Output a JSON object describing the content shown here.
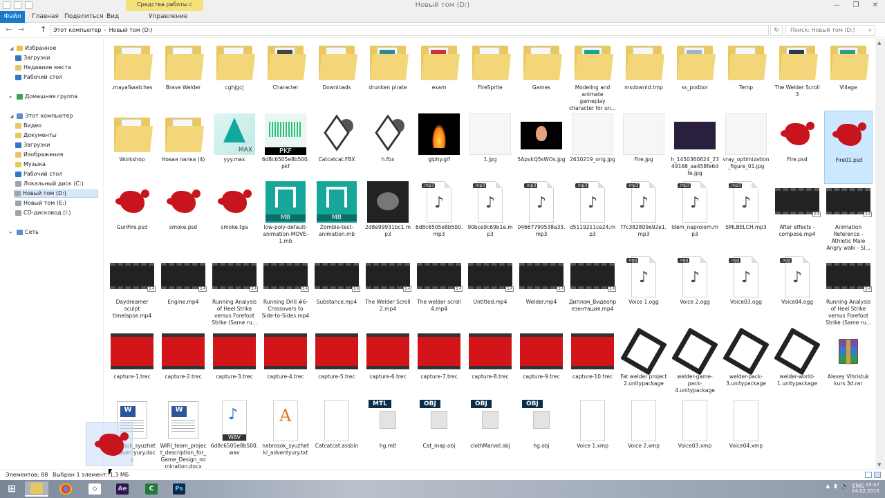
{
  "window": {
    "title": "Новый том (D:)",
    "contextual_tab": "Средства работы с рисунками",
    "minimize": "—",
    "maximize": "❐",
    "close": "✕"
  },
  "ribbon": {
    "tabs": [
      "Файл",
      "Главная",
      "Поделиться",
      "Вид",
      "Управление"
    ]
  },
  "address": {
    "back": "←",
    "forward": "→",
    "up": "↑",
    "crumbs": [
      "Этот компьютер",
      "Новый том (D:)"
    ],
    "refresh": "↻",
    "search_placeholder": "Поиск: Новый том (D:)"
  },
  "sidebar": {
    "favorites": "Избранное",
    "fav_items": [
      "Загрузки",
      "Недавние места",
      "Рабочий стол"
    ],
    "homegroup": "Домашняя группа",
    "computer": "Этот компьютер",
    "pc_items": [
      "Видео",
      "Документы",
      "Загрузки",
      "Изображения",
      "Музыка",
      "Рабочий стол",
      "Локальный диск (C:)",
      "Новый том (D:)",
      "Новый том (E:)",
      "CD-дисковод (I:)"
    ],
    "network": "Сеть"
  },
  "files": [
    {
      "name": ".mayaSwatches",
      "kind": "folder"
    },
    {
      "name": "Brave Welder",
      "kind": "folder"
    },
    {
      "name": "cghjgcj",
      "kind": "folder"
    },
    {
      "name": "Character",
      "kind": "folder"
    },
    {
      "name": "Downloads",
      "kind": "folder"
    },
    {
      "name": "drunken pirate",
      "kind": "folder"
    },
    {
      "name": "exam",
      "kind": "folder"
    },
    {
      "name": "FireSprite",
      "kind": "folder"
    },
    {
      "name": "Games",
      "kind": "folder"
    },
    {
      "name": "Modeling and animate gameplay character for un...",
      "kind": "folder"
    },
    {
      "name": "msdownld.tmp",
      "kind": "folder"
    },
    {
      "name": "ss_podbor",
      "kind": "folder"
    },
    {
      "name": "Temp",
      "kind": "folder"
    },
    {
      "name": "The Welder Scroll 3",
      "kind": "folder"
    },
    {
      "name": "Village",
      "kind": "folder"
    },
    {
      "name": "Workshop",
      "kind": "folder"
    },
    {
      "name": "Новая папка (4)",
      "kind": "folder"
    },
    {
      "name": "yyy.max",
      "kind": "max"
    },
    {
      "name": "6d8c6505e8b500.pkf",
      "kind": "pkf"
    },
    {
      "name": "Catcatcat.FBX",
      "kind": "fbx"
    },
    {
      "name": "h.fbx",
      "kind": "fbx"
    },
    {
      "name": "giphy.gif",
      "kind": "fire"
    },
    {
      "name": "1.jpg",
      "kind": "light"
    },
    {
      "name": "5ApvkQ5sWOs.jpg",
      "kind": "egg"
    },
    {
      "name": "2610219_orig.jpg",
      "kind": "light"
    },
    {
      "name": "Fire.jpg",
      "kind": "light"
    },
    {
      "name": "h_1450360624_2349168_aa458fe6dfe.jpg",
      "kind": "dark"
    },
    {
      "name": "vray_optimization_figure_01.jpg",
      "kind": "light"
    },
    {
      "name": "Fire.psd",
      "kind": "psd"
    },
    {
      "name": "Fire01.psd",
      "kind": "psd",
      "selected": true
    },
    {
      "name": "GunFire.psd",
      "kind": "psd"
    },
    {
      "name": "smoke.psd",
      "kind": "psd"
    },
    {
      "name": "smoke.tga",
      "kind": "psd"
    },
    {
      "name": "low-poly-default-animation-MOVE-1.mb",
      "kind": "mb"
    },
    {
      "name": "Zombie-test-animation.mb",
      "kind": "mb"
    },
    {
      "name": "2d8e99931bc1.mp3",
      "kind": "heart"
    },
    {
      "name": "6d8c6505e8b500.mp3",
      "kind": "mp3"
    },
    {
      "name": "90bce9c69b1e.mp3",
      "kind": "mp3"
    },
    {
      "name": "04667799538a33.mp3",
      "kind": "mp3"
    },
    {
      "name": "d5119211ce24.mp3",
      "kind": "mp3"
    },
    {
      "name": "f7c382809e92e1.mp3",
      "kind": "mp3"
    },
    {
      "name": "ldem_naprolom.mp3",
      "kind": "mp3"
    },
    {
      "name": "SMLBELCH.mp3",
      "kind": "mp3"
    },
    {
      "name": "After effects - compose.mp4",
      "kind": "video"
    },
    {
      "name": "Animation Reference - Athletic Male Angry walk - Sl...",
      "kind": "video"
    },
    {
      "name": "Daydreamer sculpt timelapse.mp4",
      "kind": "video"
    },
    {
      "name": "Engine.mp4",
      "kind": "video"
    },
    {
      "name": "Running Analysis of Heel Strike versus Forefoot Strike (Same ru...",
      "kind": "video"
    },
    {
      "name": "Running Drill #6- Crossovers to Side-to-Sides.mp4",
      "kind": "video"
    },
    {
      "name": "Substance.mp4",
      "kind": "video"
    },
    {
      "name": "The Welder Scroll 2.mp4",
      "kind": "video"
    },
    {
      "name": "The welder scroll 4.mp4",
      "kind": "video"
    },
    {
      "name": "Untitled.mp4",
      "kind": "video"
    },
    {
      "name": "Welder.mp4",
      "kind": "video"
    },
    {
      "name": "Диплом_Видеопрезентация.mp4",
      "kind": "video"
    },
    {
      "name": "Voice 1.ogg",
      "kind": "ogg"
    },
    {
      "name": "Voice 2.ogg",
      "kind": "ogg"
    },
    {
      "name": "Voice03.ogg",
      "kind": "ogg"
    },
    {
      "name": "Voice04.ogg",
      "kind": "ogg"
    },
    {
      "name": "Running Analysis of Heel Strike versus Forefoot Strike (Same ru...",
      "kind": "video"
    },
    {
      "name": "capture-1.trec",
      "kind": "trec"
    },
    {
      "name": "capture-2.trec",
      "kind": "trec"
    },
    {
      "name": "capture-3.trec",
      "kind": "trec"
    },
    {
      "name": "capture-4.trec",
      "kind": "trec"
    },
    {
      "name": "capture-5.trec",
      "kind": "trec"
    },
    {
      "name": "capture-6.trec",
      "kind": "trec"
    },
    {
      "name": "capture-7.trec",
      "kind": "trec"
    },
    {
      "name": "capture-8.trec",
      "kind": "trec"
    },
    {
      "name": "capture-9.trec",
      "kind": "trec"
    },
    {
      "name": "capture-10.trec",
      "kind": "trec"
    },
    {
      "name": "Fat welder project 2.unitypackage",
      "kind": "unity"
    },
    {
      "name": "welder-game-pack-4.unitypackage",
      "kind": "unity"
    },
    {
      "name": "welder-pack-3.unitypackage",
      "kind": "unity"
    },
    {
      "name": "welder-world-1.unitypackage",
      "kind": "unity"
    },
    {
      "name": "Alexey Vihristuk kurs 3d.rar",
      "kind": "rar"
    },
    {
      "name": "nabrosok_syuzhetki_adventyury.docx",
      "kind": "docx"
    },
    {
      "name": "WIRI_team_project_description_for_Game_Design_nomination.docx",
      "kind": "docx"
    },
    {
      "name": "6d8c6505e8b500.wav",
      "kind": "wav"
    },
    {
      "name": "nabrosok_syuzhetki_adventyury.txt",
      "kind": "txt"
    },
    {
      "name": "Catcatcat.assbin",
      "kind": "blank"
    },
    {
      "name": "hg.mtl",
      "kind": "mtl"
    },
    {
      "name": "Cat_map.obj",
      "kind": "obj"
    },
    {
      "name": "clothMarvel.obj",
      "kind": "obj"
    },
    {
      "name": "hg.obj",
      "kind": "obj"
    },
    {
      "name": "Voice 1.xmp",
      "kind": "blank"
    },
    {
      "name": "Voice 2.xmp",
      "kind": "blank"
    },
    {
      "name": "Voice03.xmp",
      "kind": "blank"
    },
    {
      "name": "Voice04.xmp",
      "kind": "blank"
    }
  ],
  "badges": {
    "mp3": ".mp3",
    "ogg": ".ogg",
    "mb": "MB",
    "max": "MAX",
    "pkf": "PKF",
    "mtl": "MTL",
    "obj": "OBJ",
    "wav": "WAV",
    "w": "W",
    "note": "♪",
    "video_tag": "3:4"
  },
  "status": {
    "count": "Элементов: 88",
    "selected": "Выбран 1 элемент: 1,3 МБ"
  },
  "taskbar": {
    "apps": [
      "start-icon",
      "explorer-icon",
      "chrome-icon",
      "unity-icon",
      "after-effects-icon",
      "camtasia-icon",
      "photoshop-icon"
    ],
    "ae_label": "Ae",
    "ps_label": "Ps",
    "tray_lang": "ENG",
    "time": "15:47",
    "date": "24.02.2016"
  },
  "colors": {
    "accent": "#1979ca",
    "contextual": "#f5e27a",
    "selection": "#cce8ff"
  }
}
